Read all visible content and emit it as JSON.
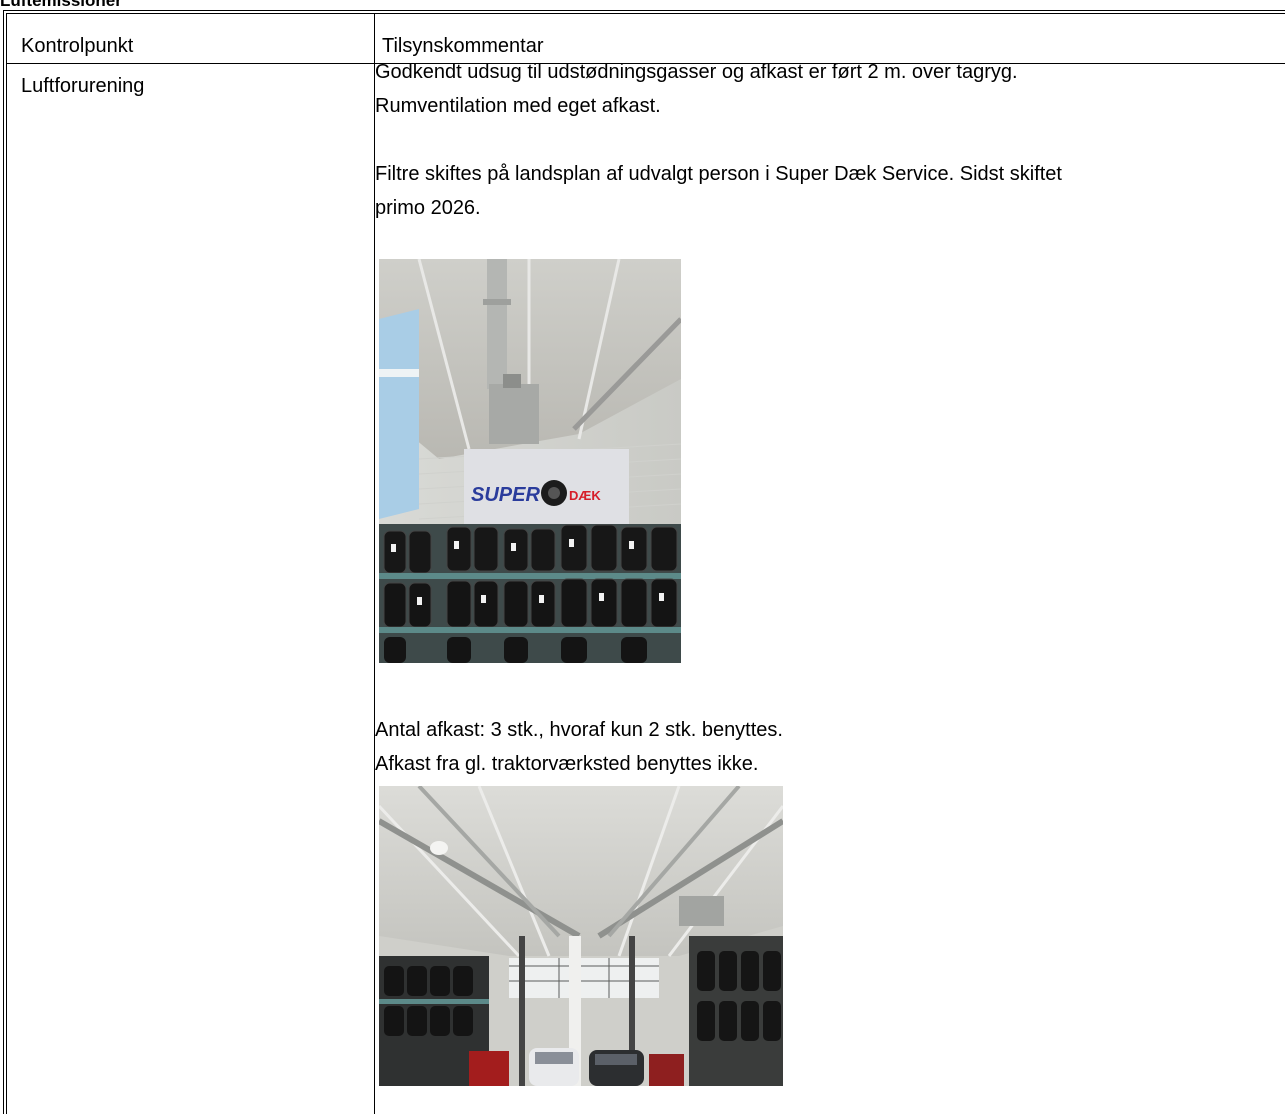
{
  "section": {
    "title": "Luftemissioner"
  },
  "table": {
    "headers": [
      "Kontrolpunkt",
      "Tilsynskommentar"
    ],
    "row": {
      "label": "Luftforurening",
      "comment_lines_top": [
        "Godkendt udsug til udstødningsgasser og afkast er ført 2 m. over tagryg.",
        "Rumventilation med eget afkast.",
        "",
        "Filtre skiftes på landsplan af udvalgt person i Super Dæk Service. Sidst skiftet",
        "primo 2026."
      ],
      "comment_lines_bottom": [
        "Antal afkast: 3 stk., hvoraf kun 2 stk. benyttes.",
        "Afkast fra gl. traktorværksted benyttes ikke."
      ]
    }
  },
  "photo1": {
    "logo_left": "SUPER",
    "logo_right": "DÆK"
  }
}
